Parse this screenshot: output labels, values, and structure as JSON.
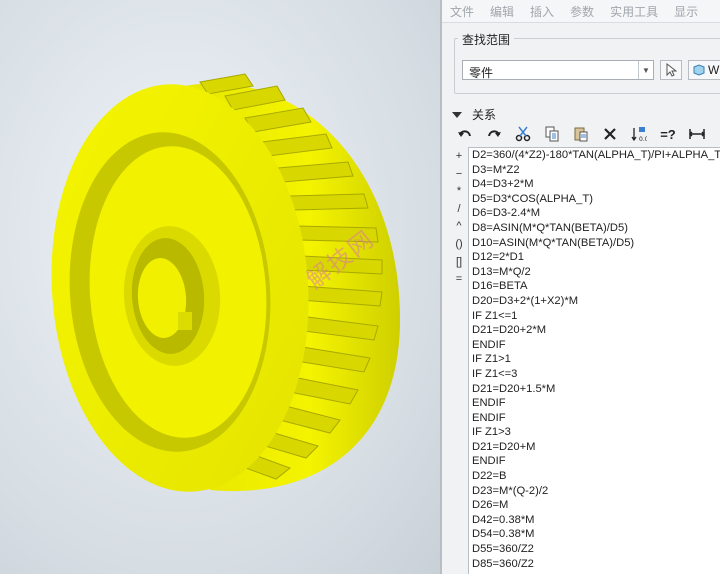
{
  "menubar": {
    "items": [
      "文件",
      "编辑",
      "插入",
      "参数",
      "实用工具",
      "显示"
    ]
  },
  "find_scope": {
    "legend": "查找范围",
    "select_value": "零件",
    "w_button_label": "W"
  },
  "relations": {
    "section_label": "关系",
    "toolbar_icons": [
      "undo-icon",
      "redo-icon",
      "cut-icon",
      "copy-icon",
      "paste-icon",
      "delete-icon",
      "sort-icon",
      "evaluate-icon",
      "measure-icon"
    ],
    "evaluate_label": "=?",
    "side_operators": [
      "+",
      "−",
      "*",
      "/",
      "^",
      "()",
      "[]",
      "="
    ],
    "lines": [
      "D2=360/(4*Z2)-180*TAN(ALPHA_T)/PI+ALPHA_T",
      "D3=M*Z2",
      "D4=D3+2*M",
      "D5=D3*COS(ALPHA_T)",
      "D6=D3-2.4*M",
      "D8=ASIN(M*Q*TAN(BETA)/D5)",
      "D10=ASIN(M*Q*TAN(BETA)/D5)",
      "D12=2*D1",
      "D13=M*Q/2",
      "D16=BETA",
      "D20=D3+2*(1+X2)*M",
      "IF Z1<=1",
      "D21=D20+2*M",
      "ENDIF",
      "IF Z1>1",
      "IF Z1<=3",
      "D21=D20+1.5*M",
      "ENDIF",
      "ENDIF",
      "IF Z1>3",
      "D21=D20+M",
      "ENDIF",
      "D22=B",
      "D23=M*(Q-2)/2",
      "D26=M",
      "D42=0.38*M",
      "D54=0.38*M",
      "D55=360/Z2",
      "D85=360/Z2"
    ]
  },
  "viewport": {
    "model": "yellow-worm-gear",
    "watermark": "解技网"
  },
  "colors": {
    "gear_yellow": "#f2f200",
    "gear_shadow": "#c8c800",
    "viewport_bg": "#dfe5ea",
    "panel_bg": "#f0f2f4"
  }
}
